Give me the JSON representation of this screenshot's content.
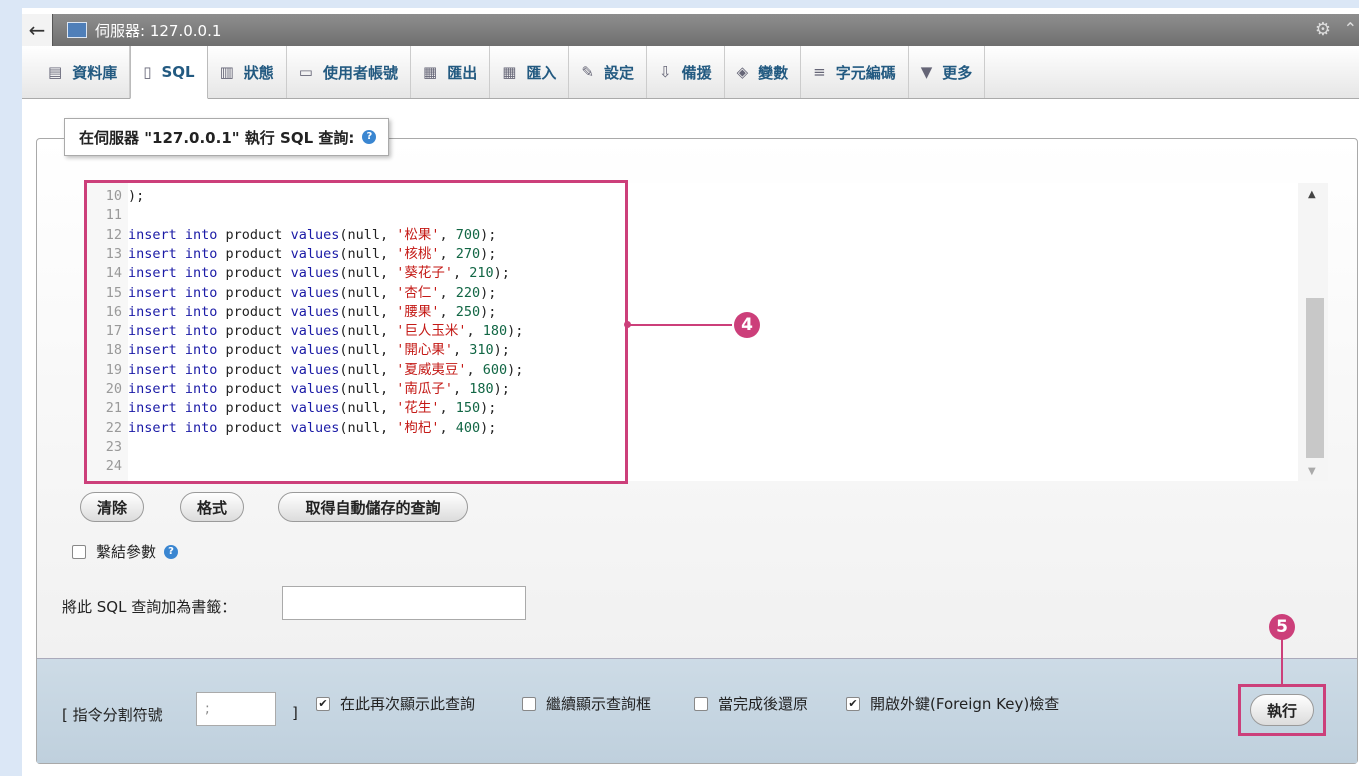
{
  "titlebar": {
    "back": "←",
    "server": "伺服器: 127.0.0.1"
  },
  "tabs": [
    {
      "label": "資料庫",
      "icon": "database-icon"
    },
    {
      "label": "SQL",
      "icon": "sql-icon",
      "active": true
    },
    {
      "label": "狀態",
      "icon": "status-icon"
    },
    {
      "label": "使用者帳號",
      "icon": "user-accounts-icon"
    },
    {
      "label": "匯出",
      "icon": "export-icon"
    },
    {
      "label": "匯入",
      "icon": "import-icon"
    },
    {
      "label": "設定",
      "icon": "settings-icon"
    },
    {
      "label": "備援",
      "icon": "replication-icon"
    },
    {
      "label": "變數",
      "icon": "variables-icon"
    },
    {
      "label": "字元編碼",
      "icon": "charset-icon"
    },
    {
      "label": "更多",
      "icon": "more-icon"
    }
  ],
  "query_panel": {
    "legend": "在伺服器 \"127.0.0.1\" 執行 SQL 查詢:"
  },
  "editor": {
    "lines": [
      {
        "n": "10",
        "text": ");"
      },
      {
        "n": "11",
        "text": ""
      },
      {
        "n": "12",
        "name": "松果",
        "price": "700"
      },
      {
        "n": "13",
        "name": "核桃",
        "price": "270"
      },
      {
        "n": "14",
        "name": "葵花子",
        "price": "210"
      },
      {
        "n": "15",
        "name": "杏仁",
        "price": "220"
      },
      {
        "n": "16",
        "name": "腰果",
        "price": "250"
      },
      {
        "n": "17",
        "name": "巨人玉米",
        "price": "180"
      },
      {
        "n": "18",
        "name": "開心果",
        "price": "310"
      },
      {
        "n": "19",
        "name": "夏威夷豆",
        "price": "600"
      },
      {
        "n": "20",
        "name": "南瓜子",
        "price": "180"
      },
      {
        "n": "21",
        "name": "花生",
        "price": "150"
      },
      {
        "n": "22",
        "name": "枸杞",
        "price": "400"
      },
      {
        "n": "23",
        "text": ""
      },
      {
        "n": "24",
        "text": ""
      }
    ],
    "insert_prefix": "insert into product values(null, "
  },
  "buttons": {
    "clear": "清除",
    "format": "格式",
    "autosave": "取得自動儲存的查詢",
    "go": "執行"
  },
  "bind_params": "繫結參數",
  "bookmark_label": "將此 SQL 查詢加為書籤：",
  "options": {
    "delimiter_label": "[ 指令分割符號",
    "delimiter_value": ";",
    "delimiter_close": "]",
    "show_query": "在此再次顯示此查詢",
    "retain_box": "繼續顯示查詢框",
    "rollback": "當完成後還原",
    "foreign_keys": "開啟外鍵(Foreign Key)檢查"
  },
  "callouts": {
    "four": "4",
    "five": "5"
  },
  "colors": {
    "callout": "#cc3f7a",
    "tab_text": "#235a81"
  }
}
